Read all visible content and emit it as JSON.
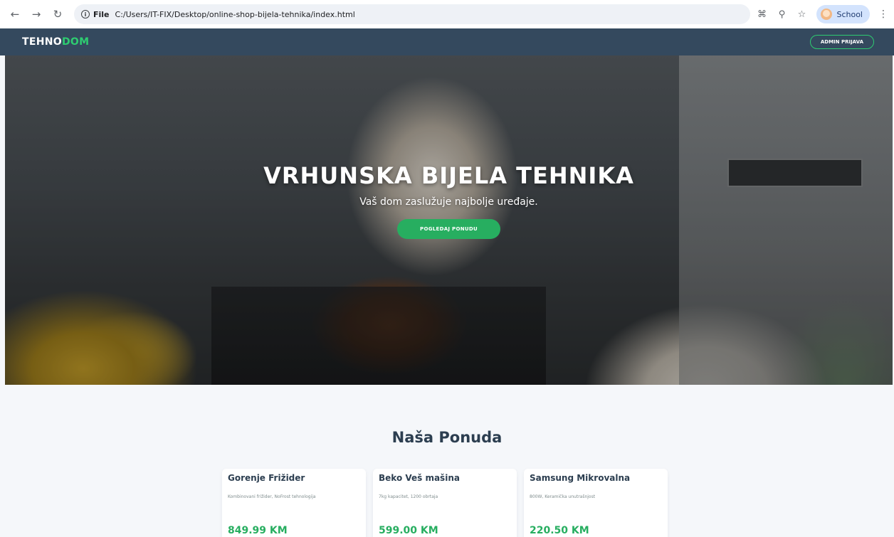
{
  "browser": {
    "url_label": "File",
    "url": "C:/Users/IT-FIX/Desktop/online-shop-bijela-tehnika/index.html",
    "profile_name": "School"
  },
  "header": {
    "logo_part1": "TEHNO",
    "logo_part2": "DOM",
    "admin_button": "ADMIN PRIJAVA",
    "colors": {
      "background": "#34495e",
      "accent": "#2ecc71"
    }
  },
  "hero": {
    "title": "VRHUNSKA BIJELA TEHNIKA",
    "subtitle": "Vaš dom zaslužuje najbolje uređaje.",
    "cta_button": "POGLEDAJ PONUDU"
  },
  "offers": {
    "title": "Naša Ponuda",
    "products": [
      {
        "name": "Gorenje Frižider",
        "description": "Kombinovani frižider, NoFrost tehnologija",
        "price": "849.99 KM"
      },
      {
        "name": "Beko Veš mašina",
        "description": "7kg kapacitet, 1200 obrtaja",
        "price": "599.00 KM"
      },
      {
        "name": "Samsung Mikrovalna",
        "description": "800W, Keramička unutrašnjost",
        "price": "220.50 KM"
      }
    ]
  }
}
